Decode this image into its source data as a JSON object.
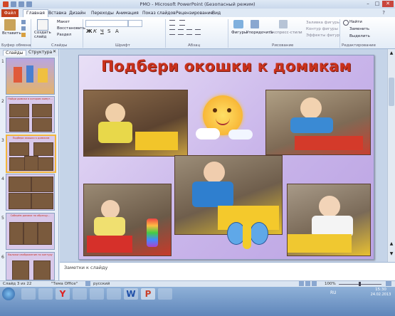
{
  "window": {
    "title": "PMO - Microsoft PowerPoint (Безопасный режим)"
  },
  "tabs": {
    "file": "Файл",
    "items": [
      "Главная",
      "Вставка",
      "Дизайн",
      "Переходы",
      "Анимация",
      "Показ слайдов",
      "Рецензирование",
      "Вид"
    ]
  },
  "ribbon": {
    "clipboard": {
      "paste": "Вставить",
      "label": "Буфер обмена"
    },
    "slides": {
      "create": "Создать слайд",
      "layout": "Макет",
      "reset": "Восстановить",
      "section": "Раздел",
      "label": "Слайды"
    },
    "font": {
      "label": "Шрифт"
    },
    "paragraph": {
      "label": "Абзац"
    },
    "drawing": {
      "shapes": "Фигуры",
      "arrange": "Упорядочить",
      "quick_styles": "Экспресс-стили",
      "fill": "Заливка фигуры",
      "outline": "Контур фигуры",
      "effects": "Эффекты фигур",
      "label": "Рисование"
    },
    "editing": {
      "find": "Найти",
      "replace": "Заменить",
      "select": "Выделить",
      "label": "Редактирование"
    }
  },
  "left_pane": {
    "tab_slides": "Слайды",
    "tab_outline": "Структура",
    "thumbnails": [
      {
        "num": "1",
        "title": "",
        "selected": false
      },
      {
        "num": "2",
        "title": "Найди домики в котором живут...",
        "selected": false
      },
      {
        "num": "3",
        "title": "Подбери окошки к домикам",
        "selected": true
      },
      {
        "num": "4",
        "title": "",
        "selected": false
      },
      {
        "num": "5",
        "title": "Соберём домики по образцу...",
        "selected": false
      },
      {
        "num": "6",
        "title": "Выложи изображение по контуру",
        "selected": false
      }
    ]
  },
  "slide": {
    "title": "Подбери окошки к домикам"
  },
  "notes": {
    "placeholder": "Заметки к слайду"
  },
  "status": {
    "slide_info": "Слайд 3 из 22",
    "theme": "\"Тема Office\"",
    "language": "русский",
    "zoom": "100%"
  },
  "taskbar": {
    "language": "RU",
    "time": "15:30",
    "date": "24.02.2013"
  },
  "colors": {
    "file_tab": "#c1411e",
    "slide_title": "#c9321d",
    "selected_thumb_border": "#f2b63d"
  }
}
